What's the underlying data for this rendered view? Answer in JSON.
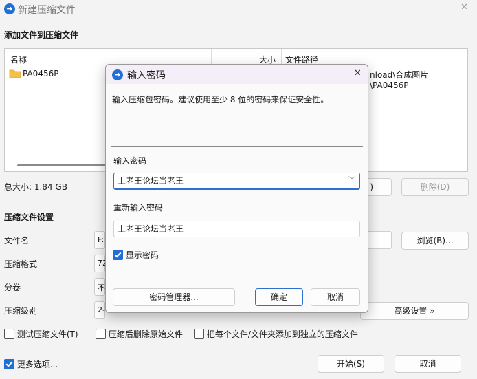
{
  "window": {
    "title": "新建压缩文件",
    "close_glyph": "✕"
  },
  "add_section": {
    "title": "添加文件到压缩文件",
    "columns": {
      "name": "名称",
      "size": "大小",
      "path": "文件路径"
    },
    "files": [
      {
        "name": "PA0456P",
        "path_visible": "nload\\合成图片\\PA0456P"
      }
    ],
    "total_size": "总大小: 1.84 GB",
    "delete_button": "删除(D)",
    "hidden_button_fragment": ")"
  },
  "settings": {
    "title": "压缩文件设置",
    "filename_label": "文件名",
    "filename_value_fragment": "F:",
    "format_label": "压缩格式",
    "format_value_fragment": "72",
    "split_label": "分卷",
    "split_value_fragment": "不",
    "level_label": "压缩级别",
    "level_value_fragment": "2-",
    "browse_button": "浏览(B)...",
    "advanced_button": "高级设置 »"
  },
  "options": {
    "test_archive": "测试压缩文件(T)",
    "delete_after": "压缩后删除原始文件",
    "separate_archives": "把每个文件/文件夹添加到独立的压缩文件",
    "more_options": "更多选项..."
  },
  "footer": {
    "start_button": "开始(S)",
    "cancel_button": "取消"
  },
  "dialog": {
    "title": "输入密码",
    "close_glyph": "✕",
    "description": "输入压缩包密码。建议使用至少 8 位的密码来保证安全性。",
    "password_label": "输入密码",
    "password_value": "上老王论坛当老王",
    "reenter_label": "重新输入密码",
    "reenter_value": "上老王论坛当老王",
    "show_password_label": "显示密码",
    "manager_button": "密码管理器...",
    "ok_button": "确定",
    "cancel_button": "取消"
  },
  "colors": {
    "accent": "#1f6fd6",
    "dialog_title_bg": "#f3eef7",
    "window_bg": "#f3f3f3"
  }
}
